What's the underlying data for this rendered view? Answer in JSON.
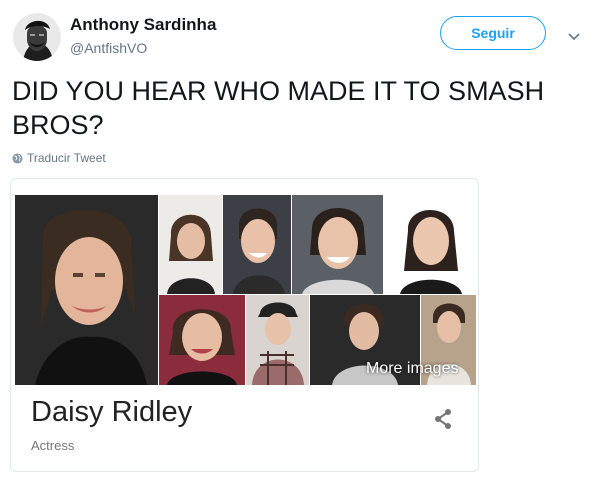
{
  "user": {
    "display_name": "Anthony Sardinha",
    "handle": "@AntfishVO"
  },
  "follow_button_label": "Seguir",
  "tweet_text": "DID YOU HEAR WHO MADE IT TO SMASH BROS?",
  "translate_label": "Traducir Tweet",
  "card": {
    "more_images_label": "More images",
    "title": "Daisy Ridley",
    "subtitle": "Actress"
  },
  "icons": {
    "chevron": "chevron-down-icon",
    "globe": "globe-icon",
    "share": "share-icon"
  },
  "colors": {
    "accent": "#1da1f2",
    "text": "#14171a",
    "muted": "#657786",
    "border": "#e1e8ed"
  }
}
